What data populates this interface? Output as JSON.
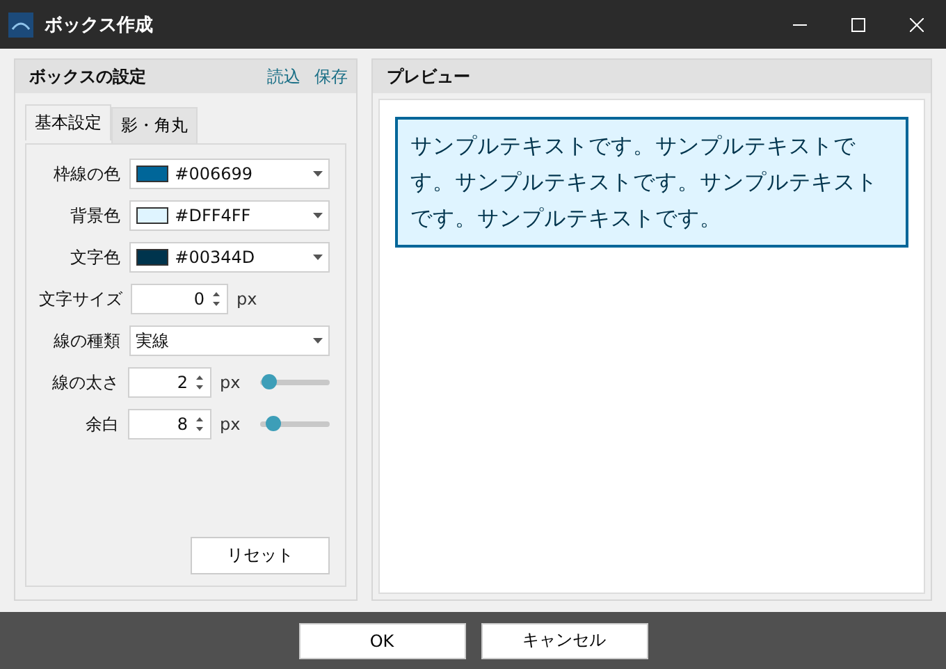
{
  "window": {
    "title": "ボックス作成"
  },
  "settings_panel": {
    "title": "ボックスの設定",
    "links": [
      "読込",
      "保存"
    ],
    "tabs": [
      {
        "label": "基本設定",
        "selected": true
      },
      {
        "label": "影・角丸",
        "selected": false
      }
    ],
    "rows": [
      {
        "kind": "color",
        "label": "枠線の色",
        "value": "#006699"
      },
      {
        "kind": "color",
        "label": "背景色",
        "value": "#DFF4FF"
      },
      {
        "kind": "color",
        "label": "文字色",
        "value": "#00344D"
      },
      {
        "kind": "spin",
        "label": "文字サイズ",
        "value": "0",
        "unit": "px"
      },
      {
        "kind": "select",
        "label": "線の種類",
        "value": "実線"
      },
      {
        "kind": "spin_slider",
        "label": "線の太さ",
        "value": "2",
        "unit": "px",
        "level": 0.12
      },
      {
        "kind": "spin_slider",
        "label": "余白",
        "value": "8",
        "unit": "px",
        "level": 0.18
      }
    ],
    "reset_button": "リセット"
  },
  "preview_panel": {
    "title": "プレビュー",
    "text": "サンプルテキストです。サンプルテキストです。サンプルテキストです。サンプルテキストです。サンプルテキストです。"
  },
  "buttons": [
    "OK",
    "キャンセル"
  ]
}
